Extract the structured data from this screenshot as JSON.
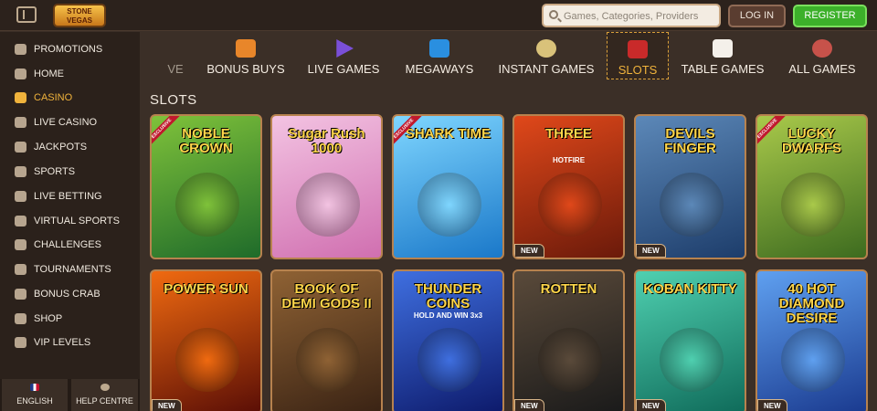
{
  "topbar": {
    "logo_text": "STONE VEGAS",
    "search_placeholder": "Games, Categories, Providers",
    "login_label": "LOG IN",
    "register_label": "REGISTER"
  },
  "sidebar": {
    "items": [
      {
        "label": "PROMOTIONS",
        "icon": "gift-icon"
      },
      {
        "label": "HOME",
        "icon": "home-icon"
      },
      {
        "label": "CASINO",
        "icon": "slot-machine-icon",
        "active": true
      },
      {
        "label": "LIVE CASINO",
        "icon": "chip-icon"
      },
      {
        "label": "JACKPOTS",
        "icon": "jackpot-icon"
      },
      {
        "label": "SPORTS",
        "icon": "ball-icon"
      },
      {
        "label": "LIVE BETTING",
        "icon": "live-icon"
      },
      {
        "label": "VIRTUAL SPORTS",
        "icon": "monitor-icon"
      },
      {
        "label": "CHALLENGES",
        "icon": "target-icon"
      },
      {
        "label": "TOURNAMENTS",
        "icon": "trophy-icon"
      },
      {
        "label": "BONUS CRAB",
        "icon": "crab-icon"
      },
      {
        "label": "SHOP",
        "icon": "basket-icon"
      },
      {
        "label": "VIP LEVELS",
        "icon": "crown-icon"
      }
    ],
    "bottom": {
      "language_label": "ENGLISH",
      "help_label": "HELP CENTRE"
    }
  },
  "categories": [
    {
      "label": "VE",
      "icon": "partial-icon"
    },
    {
      "label": "BONUS BUYS",
      "icon": "gift-box-icon"
    },
    {
      "label": "LIVE GAMES",
      "icon": "play-triangle-icon"
    },
    {
      "label": "MEGAWAYS",
      "icon": "megaways-m-icon"
    },
    {
      "label": "INSTANT GAMES",
      "icon": "joystick-icon"
    },
    {
      "label": "SLOTS",
      "icon": "seven-seven-seven-icon",
      "active": true
    },
    {
      "label": "TABLE GAMES",
      "icon": "cards-icon"
    },
    {
      "label": "ALL GAMES",
      "icon": "meat-icon"
    }
  ],
  "section_title": "SLOTS",
  "games": [
    {
      "title": "NOBLE CROWN",
      "subtitle": "",
      "badge": "EXCLUSIVE",
      "colors": [
        "#1f6b2a",
        "#7fc23a"
      ]
    },
    {
      "title": "Sugar Rush 1000",
      "subtitle": "",
      "badge": "",
      "colors": [
        "#d06fb0",
        "#f3c3e2"
      ]
    },
    {
      "title": "SHARK TIME",
      "subtitle": "",
      "badge": "EXCLUSIVE",
      "colors": [
        "#1a78c9",
        "#7fd6ff"
      ]
    },
    {
      "title": "THREE",
      "subtitle": "HOTFIRE",
      "badge": "NEW",
      "colors": [
        "#6b1a0a",
        "#e0481a"
      ]
    },
    {
      "title": "DEVILS FINGER",
      "subtitle": "",
      "badge": "NEW",
      "colors": [
        "#1d3d6b",
        "#5c88b8"
      ]
    },
    {
      "title": "LUCKY DWARFS",
      "subtitle": "",
      "badge": "EXCLUSIVE",
      "colors": [
        "#3d6b1f",
        "#a9c94a"
      ]
    },
    {
      "title": "POWER SUN",
      "subtitle": "",
      "badge": "NEW",
      "colors": [
        "#5a0e06",
        "#f06a10"
      ]
    },
    {
      "title": "BOOK OF DEMI GODS II",
      "subtitle": "",
      "badge": "",
      "colors": [
        "#3a2314",
        "#8f6234"
      ]
    },
    {
      "title": "THUNDER COINS",
      "subtitle": "HOLD AND WIN 3x3",
      "badge": "",
      "colors": [
        "#0d1a6b",
        "#3f6fe0"
      ]
    },
    {
      "title": "ROTTEN",
      "subtitle": "",
      "badge": "NEW",
      "colors": [
        "#1a1a1a",
        "#5a4a3a"
      ]
    },
    {
      "title": "KOBAN KITTY",
      "subtitle": "",
      "badge": "NEW",
      "colors": [
        "#0f6b5a",
        "#4fd0b0"
      ]
    },
    {
      "title": "40 HOT DIAMOND DESIRE",
      "subtitle": "",
      "badge": "NEW",
      "colors": [
        "#1a3a8f",
        "#5fa0f0"
      ]
    }
  ]
}
